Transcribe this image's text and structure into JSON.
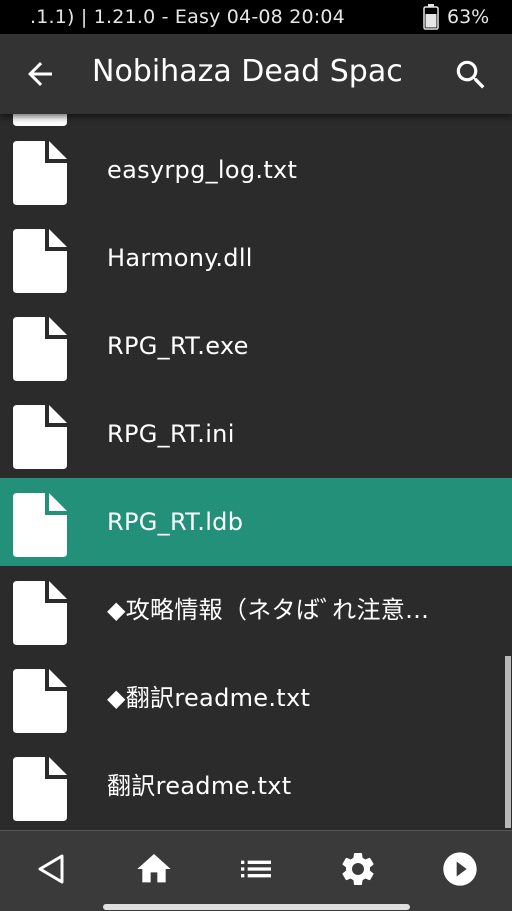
{
  "status_bar": {
    "text": ".1.1)   |   1.21.0 - Easy    04-08 20:04",
    "battery": "63%"
  },
  "app_bar": {
    "title": "Nobihaza Dead Spac"
  },
  "files": [
    {
      "name": "easyrpg_log.txt",
      "selected": false
    },
    {
      "name": "Harmony.dll",
      "selected": false
    },
    {
      "name": "RPG_RT.exe",
      "selected": false
    },
    {
      "name": "RPG_RT.ini",
      "selected": false
    },
    {
      "name": "RPG_RT.ldb",
      "selected": true
    },
    {
      "name": "◆攻略情報（ネタばﾞれ注意…",
      "selected": false
    },
    {
      "name": "◆翻訳readme.txt",
      "selected": false
    },
    {
      "name": "翻訳readme.txt",
      "selected": false
    }
  ],
  "colors": {
    "selected_row": "#23917a",
    "background": "#2b2b2b"
  },
  "icons": {
    "back": "arrow-left-icon",
    "search": "search-icon",
    "file": "file-icon",
    "nav": [
      "triangle-back-icon",
      "home-icon",
      "list-icon",
      "gear-icon",
      "play-icon"
    ]
  }
}
